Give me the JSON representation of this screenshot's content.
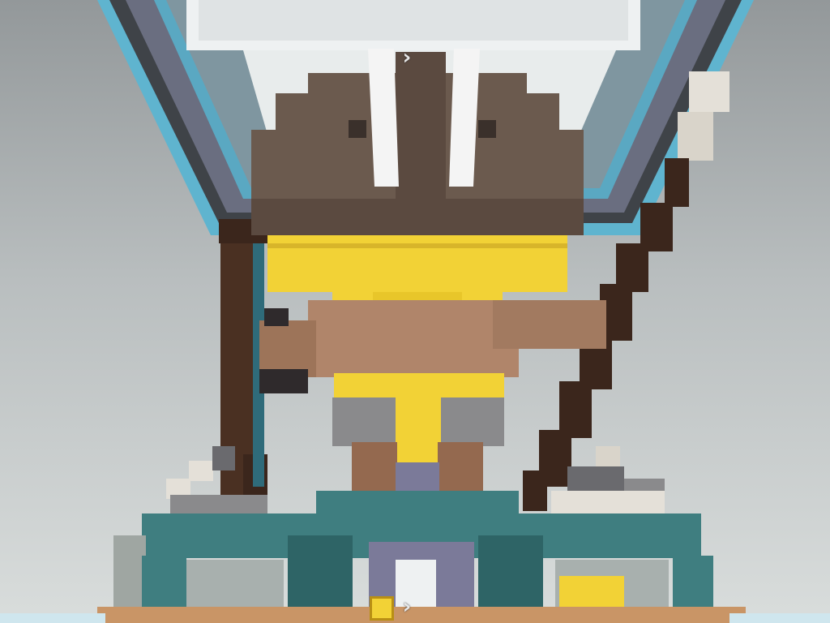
{
  "scene": {
    "description_icon": "voxel-statue",
    "colors": {
      "sky_top": "#93989a",
      "sky_bottom": "#d9dddc",
      "water_blue": "#5fb4cf",
      "frame_dark": "#3f4348",
      "frame_slate": "#6a6e80",
      "ceiling_white": "#eef1f2",
      "hair_brown": "#6b5a4e",
      "hair_brown_dark": "#4f4138",
      "horn_white": "#f4f4f4",
      "gold": "#f2d236",
      "gold_dark": "#c9a51d",
      "skin_tan": "#b0856a",
      "skin_tan_dark": "#94694f",
      "skirt_grey": "#8a8a8c",
      "bow_dark": "#3b261c",
      "teal_base": "#3f7e80",
      "teal_base_dark": "#2e6466",
      "purple_stone": "#7b7a99",
      "sand": "#c99566",
      "pale_block": "#e4e0d8",
      "dark_block": "#6a6a6e"
    }
  },
  "hud": {
    "crosshair_top_glyph": "›",
    "crosshair_bottom_glyph": "›",
    "hotbar_item_color": "#f2d236"
  }
}
